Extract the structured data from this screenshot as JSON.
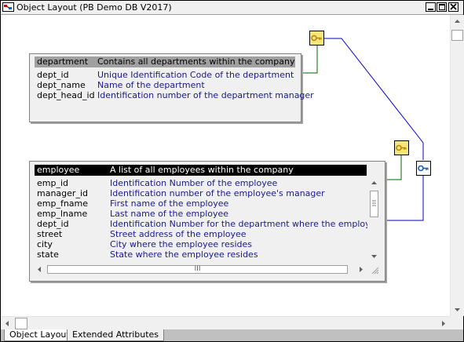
{
  "window": {
    "title": "Object Layout (PB Demo DB V2017)",
    "buttons": [
      "minimize",
      "restore",
      "close"
    ]
  },
  "department_table": {
    "name": "department",
    "comment": "Contains all departments within the company",
    "columns": [
      {
        "name": "dept_id",
        "desc": "Unique Identification Code of the department"
      },
      {
        "name": "dept_name",
        "desc": "Name of the department"
      },
      {
        "name": "dept_head_id",
        "desc": "Identification number of the department manager"
      }
    ]
  },
  "employee_table": {
    "name": "employee",
    "comment": "A list of all employees within the company",
    "columns": [
      {
        "name": "emp_id",
        "desc": "Identification Number of the employee"
      },
      {
        "name": "manager_id",
        "desc": "Identification number of the employee's manager"
      },
      {
        "name": "emp_fname",
        "desc": "First name of the employee"
      },
      {
        "name": "emp_lname",
        "desc": "Last name of the employee"
      },
      {
        "name": "dept_id",
        "desc": "Identification Number for the department where the employee works"
      },
      {
        "name": "street",
        "desc": "Street address of the employee"
      },
      {
        "name": "city",
        "desc": "City where the employee resides"
      },
      {
        "name": "state",
        "desc": "State where the employee resides"
      }
    ],
    "hscroll_grip": "III"
  },
  "tabs": [
    {
      "label": "Object Layout",
      "active": true
    },
    {
      "label": "Extended Attributes",
      "active": false
    }
  ],
  "colors": {
    "relationship_line": "#0000cc",
    "key_line": "#006400",
    "column_desc": "#1a1a8c",
    "header_gray": "#a0a0a0",
    "header_selected": "#000000"
  },
  "icons": [
    "window-icon",
    "key-icon",
    "foreign-key-icon"
  ]
}
